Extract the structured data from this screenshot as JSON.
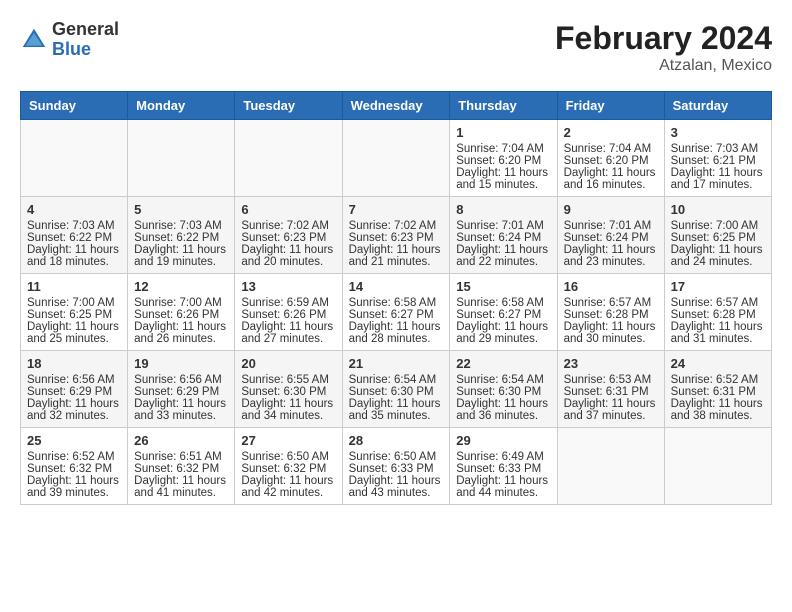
{
  "header": {
    "logo_general": "General",
    "logo_blue": "Blue",
    "month_year": "February 2024",
    "location": "Atzalan, Mexico"
  },
  "days_of_week": [
    "Sunday",
    "Monday",
    "Tuesday",
    "Wednesday",
    "Thursday",
    "Friday",
    "Saturday"
  ],
  "weeks": [
    [
      {
        "day": "",
        "info": ""
      },
      {
        "day": "",
        "info": ""
      },
      {
        "day": "",
        "info": ""
      },
      {
        "day": "",
        "info": ""
      },
      {
        "day": "1",
        "info": "Sunrise: 7:04 AM\nSunset: 6:20 PM\nDaylight: 11 hours and 15 minutes."
      },
      {
        "day": "2",
        "info": "Sunrise: 7:04 AM\nSunset: 6:20 PM\nDaylight: 11 hours and 16 minutes."
      },
      {
        "day": "3",
        "info": "Sunrise: 7:03 AM\nSunset: 6:21 PM\nDaylight: 11 hours and 17 minutes."
      }
    ],
    [
      {
        "day": "4",
        "info": "Sunrise: 7:03 AM\nSunset: 6:22 PM\nDaylight: 11 hours and 18 minutes."
      },
      {
        "day": "5",
        "info": "Sunrise: 7:03 AM\nSunset: 6:22 PM\nDaylight: 11 hours and 19 minutes."
      },
      {
        "day": "6",
        "info": "Sunrise: 7:02 AM\nSunset: 6:23 PM\nDaylight: 11 hours and 20 minutes."
      },
      {
        "day": "7",
        "info": "Sunrise: 7:02 AM\nSunset: 6:23 PM\nDaylight: 11 hours and 21 minutes."
      },
      {
        "day": "8",
        "info": "Sunrise: 7:01 AM\nSunset: 6:24 PM\nDaylight: 11 hours and 22 minutes."
      },
      {
        "day": "9",
        "info": "Sunrise: 7:01 AM\nSunset: 6:24 PM\nDaylight: 11 hours and 23 minutes."
      },
      {
        "day": "10",
        "info": "Sunrise: 7:00 AM\nSunset: 6:25 PM\nDaylight: 11 hours and 24 minutes."
      }
    ],
    [
      {
        "day": "11",
        "info": "Sunrise: 7:00 AM\nSunset: 6:25 PM\nDaylight: 11 hours and 25 minutes."
      },
      {
        "day": "12",
        "info": "Sunrise: 7:00 AM\nSunset: 6:26 PM\nDaylight: 11 hours and 26 minutes."
      },
      {
        "day": "13",
        "info": "Sunrise: 6:59 AM\nSunset: 6:26 PM\nDaylight: 11 hours and 27 minutes."
      },
      {
        "day": "14",
        "info": "Sunrise: 6:58 AM\nSunset: 6:27 PM\nDaylight: 11 hours and 28 minutes."
      },
      {
        "day": "15",
        "info": "Sunrise: 6:58 AM\nSunset: 6:27 PM\nDaylight: 11 hours and 29 minutes."
      },
      {
        "day": "16",
        "info": "Sunrise: 6:57 AM\nSunset: 6:28 PM\nDaylight: 11 hours and 30 minutes."
      },
      {
        "day": "17",
        "info": "Sunrise: 6:57 AM\nSunset: 6:28 PM\nDaylight: 11 hours and 31 minutes."
      }
    ],
    [
      {
        "day": "18",
        "info": "Sunrise: 6:56 AM\nSunset: 6:29 PM\nDaylight: 11 hours and 32 minutes."
      },
      {
        "day": "19",
        "info": "Sunrise: 6:56 AM\nSunset: 6:29 PM\nDaylight: 11 hours and 33 minutes."
      },
      {
        "day": "20",
        "info": "Sunrise: 6:55 AM\nSunset: 6:30 PM\nDaylight: 11 hours and 34 minutes."
      },
      {
        "day": "21",
        "info": "Sunrise: 6:54 AM\nSunset: 6:30 PM\nDaylight: 11 hours and 35 minutes."
      },
      {
        "day": "22",
        "info": "Sunrise: 6:54 AM\nSunset: 6:30 PM\nDaylight: 11 hours and 36 minutes."
      },
      {
        "day": "23",
        "info": "Sunrise: 6:53 AM\nSunset: 6:31 PM\nDaylight: 11 hours and 37 minutes."
      },
      {
        "day": "24",
        "info": "Sunrise: 6:52 AM\nSunset: 6:31 PM\nDaylight: 11 hours and 38 minutes."
      }
    ],
    [
      {
        "day": "25",
        "info": "Sunrise: 6:52 AM\nSunset: 6:32 PM\nDaylight: 11 hours and 39 minutes."
      },
      {
        "day": "26",
        "info": "Sunrise: 6:51 AM\nSunset: 6:32 PM\nDaylight: 11 hours and 41 minutes."
      },
      {
        "day": "27",
        "info": "Sunrise: 6:50 AM\nSunset: 6:32 PM\nDaylight: 11 hours and 42 minutes."
      },
      {
        "day": "28",
        "info": "Sunrise: 6:50 AM\nSunset: 6:33 PM\nDaylight: 11 hours and 43 minutes."
      },
      {
        "day": "29",
        "info": "Sunrise: 6:49 AM\nSunset: 6:33 PM\nDaylight: 11 hours and 44 minutes."
      },
      {
        "day": "",
        "info": ""
      },
      {
        "day": "",
        "info": ""
      }
    ]
  ]
}
